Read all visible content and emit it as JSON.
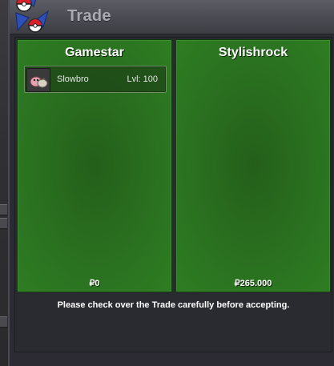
{
  "window": {
    "title": "Trade",
    "logo_icon": "pokeball-wings-icon",
    "colors": {
      "panel_green": "#2a7020",
      "title_text": "#a9aab3"
    }
  },
  "trade": {
    "left": {
      "player_name": "Gamestar",
      "items": [
        {
          "sprite_icon": "slowbro-sprite-icon",
          "name": "Slowbro",
          "level": "Lvl: 100"
        }
      ],
      "money": "₽0"
    },
    "right": {
      "player_name": "Stylishrock",
      "items": [],
      "money": "₽265.000"
    }
  },
  "notice": "Please check over the Trade carefully before accepting."
}
